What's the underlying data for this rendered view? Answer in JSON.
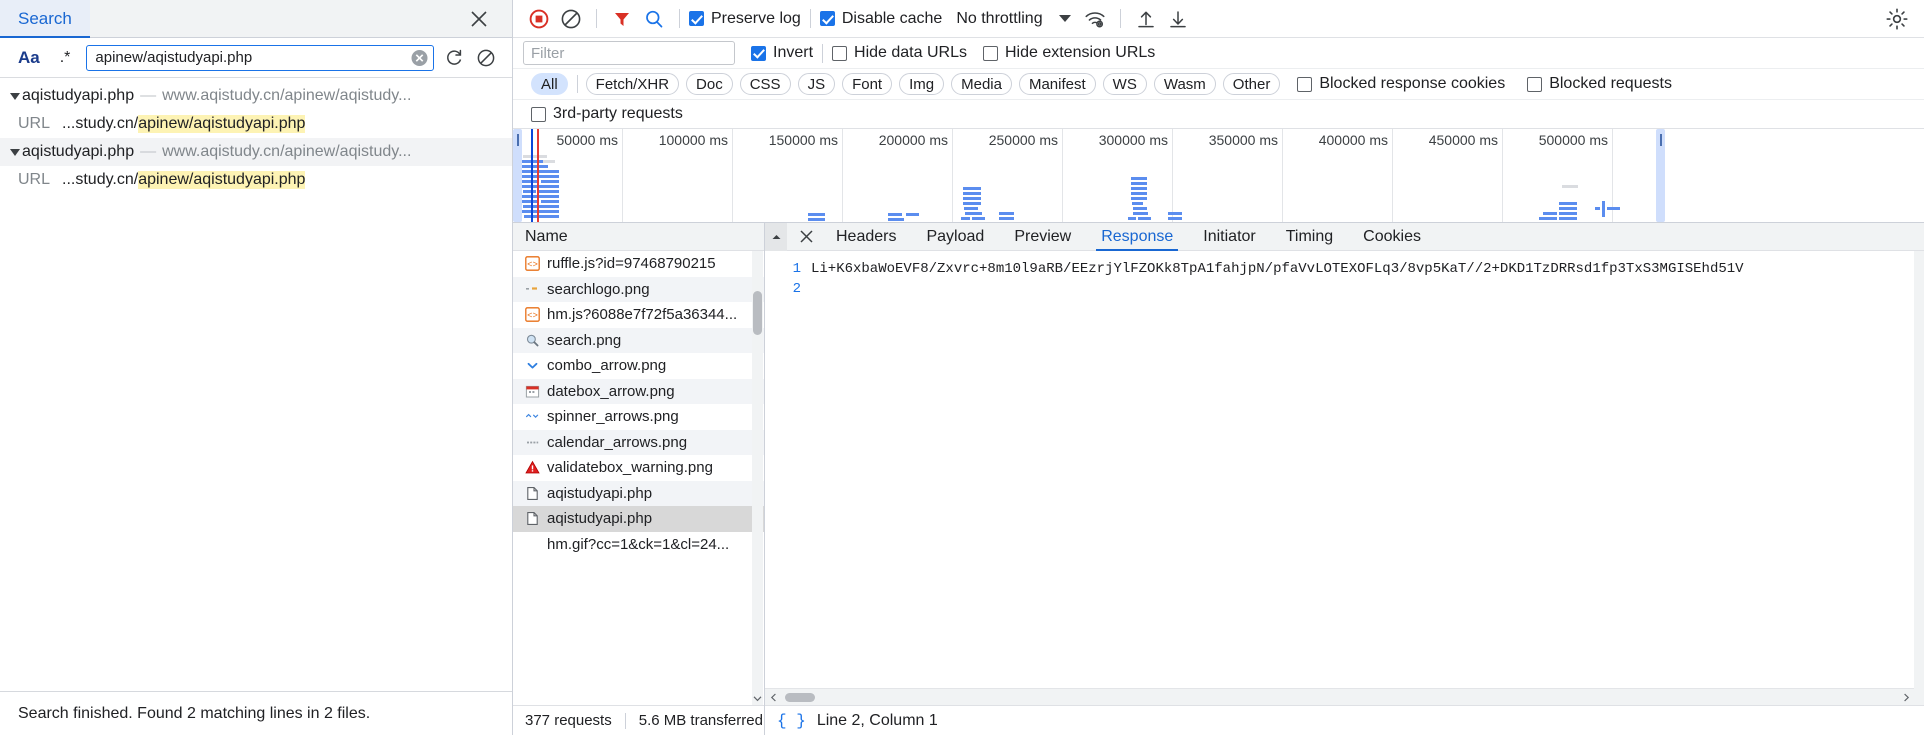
{
  "search_panel": {
    "tab_label": "Search",
    "close_icon": "close-icon",
    "match_case_label": "Aa",
    "regex_label": ".*",
    "query_value": "apinew/aqistudyapi.php",
    "query_placeholder": "Search",
    "results": [
      {
        "file": "aqistudyapi.php",
        "dash": "—",
        "url": "www.aqistudy.cn/apinew/aqistudy...",
        "line_label": "URL",
        "line_prefix": "...study.cn/",
        "line_match": "apinew/aqistudyapi.php"
      },
      {
        "file": "aqistudyapi.php",
        "dash": "—",
        "url": "www.aqistudy.cn/apinew/aqistudy...",
        "line_label": "URL",
        "line_prefix": "...study.cn/",
        "line_match": "apinew/aqistudyapi.php"
      }
    ],
    "status": "Search finished.  Found 2 matching lines in 2 files."
  },
  "network_toolbar": {
    "record_icon": "record-stop-icon",
    "clear_icon": "clear-icon",
    "filter_icon": "filter-funnel-icon",
    "search_icon": "search-icon",
    "preserve_log": {
      "label": "Preserve log",
      "checked": true
    },
    "disable_cache": {
      "label": "Disable cache",
      "checked": true
    },
    "throttling": {
      "value": "No throttling",
      "caret": "chevron-down-icon"
    },
    "network_conditions_icon": "wifi-settings-icon",
    "import_har_icon": "upload-icon",
    "export_har_icon": "download-icon",
    "settings_icon": "gear-icon"
  },
  "filter_bar": {
    "filter_placeholder": "Filter",
    "filter_value": "",
    "invert": {
      "label": "Invert",
      "checked": true
    },
    "hide_data_urls": {
      "label": "Hide data URLs",
      "checked": false
    },
    "hide_extension_urls": {
      "label": "Hide extension URLs",
      "checked": false
    }
  },
  "type_filters": {
    "pills": [
      "All",
      "Fetch/XHR",
      "Doc",
      "CSS",
      "JS",
      "Font",
      "Img",
      "Media",
      "Manifest",
      "WS",
      "Wasm",
      "Other"
    ],
    "active": "All",
    "blocked_response_cookies": {
      "label": "Blocked response cookies",
      "checked": false
    },
    "blocked_requests": {
      "label": "Blocked requests",
      "checked": false
    },
    "third_party_requests": {
      "label": "3rd-party requests",
      "checked": false
    }
  },
  "overview": {
    "tick_labels": [
      "50000 ms",
      "100000 ms",
      "150000 ms",
      "200000 ms",
      "250000 ms",
      "300000 ms",
      "350000 ms",
      "400000 ms",
      "450000 ms",
      "500000 ms"
    ],
    "unit": "ms",
    "dom_content_loaded_color": "#0d47d9",
    "load_event_color": "#e53935"
  },
  "request_list": {
    "column_header": "Name",
    "rows": [
      {
        "icon": "js-file-icon",
        "name": "ruffle.js?id=97468790215"
      },
      {
        "icon": "image-dashes-icon",
        "name": "searchlogo.png"
      },
      {
        "icon": "js-file-icon",
        "name": "hm.js?6088e7f72f5a36344..."
      },
      {
        "icon": "magnifier-image-icon",
        "name": "search.png"
      },
      {
        "icon": "chevron-down-image-icon",
        "name": "combo_arrow.png"
      },
      {
        "icon": "calendar-image-icon",
        "name": "datebox_arrow.png"
      },
      {
        "icon": "spinner-arrows-image-icon",
        "name": "spinner_arrows.png"
      },
      {
        "icon": "dots-image-icon",
        "name": "calendar_arrows.png"
      },
      {
        "icon": "warning-triangle-image-icon",
        "name": "validatebox_warning.png"
      },
      {
        "icon": "document-icon",
        "name": "aqistudyapi.php"
      },
      {
        "icon": "document-icon",
        "name": "aqistudyapi.php",
        "selected": true
      },
      {
        "icon": "none",
        "name": "hm.gif?cc=1&ck=1&cl=24..."
      }
    ]
  },
  "network_status": {
    "requests": "377 requests",
    "transferred": "5.6 MB transferred"
  },
  "detail_pane": {
    "close_icon": "close-icon",
    "scroll_up_icon": "chevron-up-icon",
    "tabs": [
      "Headers",
      "Payload",
      "Preview",
      "Response",
      "Initiator",
      "Timing",
      "Cookies"
    ],
    "active_tab": "Response",
    "code_lines": [
      {
        "number": "1",
        "text": "Li+K6xbaWoEVF8/Zxvrc+8m10l9aRB/EEzrjYlFZOKk8TpA1fahjpN/pfaVvLOTEXOFLq3/8vp5KaT//2+DKD1TzDRRsd1fp3TxS3MGISEhd51V"
      },
      {
        "number": "2",
        "text": ""
      }
    ],
    "cursor_status": "Line 2, Column 1",
    "braces_icon": "pretty-print-icon"
  }
}
